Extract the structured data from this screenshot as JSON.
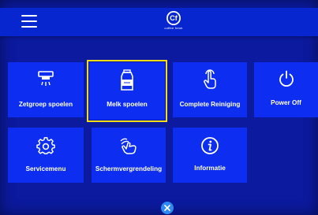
{
  "header": {
    "menu_icon": "hamburger-icon",
    "brand_name": "coffee fresh",
    "brand_logo": "Cf"
  },
  "tiles": [
    {
      "label": "Zetgroep spoelen",
      "icon": "brew-group-rinse-icon"
    },
    {
      "label": "Melk spoelen",
      "icon": "milk-carton-icon",
      "selected": true
    },
    {
      "label": "Complete Reiniging",
      "icon": "touch-hand-icon"
    },
    {
      "label": "Power Off",
      "icon": "power-icon"
    },
    {
      "label": "Servicemenu",
      "icon": "gear-icon"
    },
    {
      "label": "Schermvergrendeling",
      "icon": "hand-swipe-icon"
    },
    {
      "label": "Informatie",
      "icon": "info-icon"
    }
  ],
  "footer": {
    "close_icon": "close-icon"
  },
  "colors": {
    "background": "#0b1a9e",
    "topbar": "#0826cf",
    "tile": "#0d2ef0",
    "selection": "#f4dc17",
    "close": "#2f89f0"
  }
}
